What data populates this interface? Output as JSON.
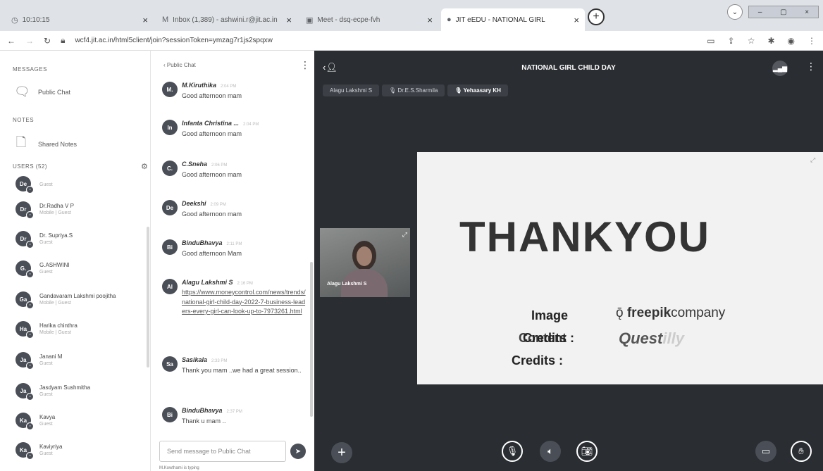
{
  "browser": {
    "tabs": [
      {
        "title": "10:10:15",
        "icon": "clock-icon"
      },
      {
        "title": "Inbox (1,389) - ashwini.r@jit.ac.in",
        "icon": "gmail-icon"
      },
      {
        "title": "Meet - dsq-ecpe-fvh",
        "icon": "meet-icon"
      },
      {
        "title": "JIT eEDU - NATIONAL GIRL",
        "icon": "bbb-icon"
      }
    ],
    "url": "wcf4.jit.ac.in/html5client/join?sessionToken=ymzag7r1js2spqxw"
  },
  "left_panel": {
    "messages_title": "MESSAGES",
    "public_chat": "Public Chat",
    "notes_title": "NOTES",
    "shared_notes": "Shared Notes",
    "users_title": "USERS (52)",
    "users": [
      {
        "initials": "De",
        "name": "",
        "role": "Guest"
      },
      {
        "initials": "Dr",
        "name": "Dr.Radha V P",
        "role": "Mobile | Guest"
      },
      {
        "initials": "Dr",
        "name": "Dr. Supriya.S",
        "role": "Guest"
      },
      {
        "initials": "G.",
        "name": "G.ASHWINI",
        "role": "Guest"
      },
      {
        "initials": "Ga",
        "name": "Gandavaram Lakshmi poojitha",
        "role": "Mobile | Guest"
      },
      {
        "initials": "Ha",
        "name": "Harika chinthra",
        "role": "Mobile | Guest"
      },
      {
        "initials": "Ja",
        "name": "Janani M",
        "role": "Guest"
      },
      {
        "initials": "Ja",
        "name": "Jasdyam Sushmitha",
        "role": "Guest"
      },
      {
        "initials": "Ka",
        "name": "Kavya",
        "role": "Guest"
      },
      {
        "initials": "Ka",
        "name": "Kaviyriya",
        "role": "Guest"
      }
    ]
  },
  "chat": {
    "back_label": "‹  Public Chat",
    "menu": "⋮",
    "messages": [
      {
        "initials": "M.",
        "name": "M.Kiruthika",
        "time": "2:04 PM",
        "text": "Good afternoon mam"
      },
      {
        "initials": "In",
        "name": "Infanta Christina ...",
        "time": "2:04 PM",
        "text": "Good afternoon mam"
      },
      {
        "initials": "C.",
        "name": "C.Sneha",
        "time": "2:06 PM",
        "text": "Good afternoon mam"
      },
      {
        "initials": "De",
        "name": "Deekshi",
        "time": "2:09 PM",
        "text": "Good afternoon mam"
      },
      {
        "initials": "Bi",
        "name": "BinduBhavya",
        "time": "2:11 PM",
        "text": "Good afternoon Mam"
      },
      {
        "initials": "Al",
        "name": "Alagu Lakshmi S",
        "time": "2:16 PM",
        "text": "https://www.moneycontrol.com/news/trends/national-girl-child-day-2022-7-business-leaders-every-girl-can-look-up-to-7973261.html"
      },
      {
        "initials": "Sa",
        "name": "Sasikala",
        "time": "2:33 PM",
        "text": "Thank you mam ..we had a great session.."
      },
      {
        "initials": "Bi",
        "name": "BinduBhavya",
        "time": "2:37 PM",
        "text": "Thank u mam .."
      }
    ],
    "input_placeholder": "Send message to Public Chat",
    "typing": "M.Kowthami is typing"
  },
  "stage": {
    "title": "NATIONAL GIRL CHILD DAY",
    "talkers": [
      "Alagu Lakshmi S",
      "Dr.E.S.Sharmila",
      "Yehaasary KH"
    ],
    "webcam_name": "Alagu Lakshmi S",
    "slide": {
      "heading": "THANKYOU",
      "image_label": "Image",
      "credits_label": "Credits :",
      "content_label": "Content",
      "credits_label2": "Credits :",
      "freepik_bold": "freepik",
      "freepik_rest": "company",
      "quest_a": "Quest",
      "quest_b": "illy"
    }
  }
}
